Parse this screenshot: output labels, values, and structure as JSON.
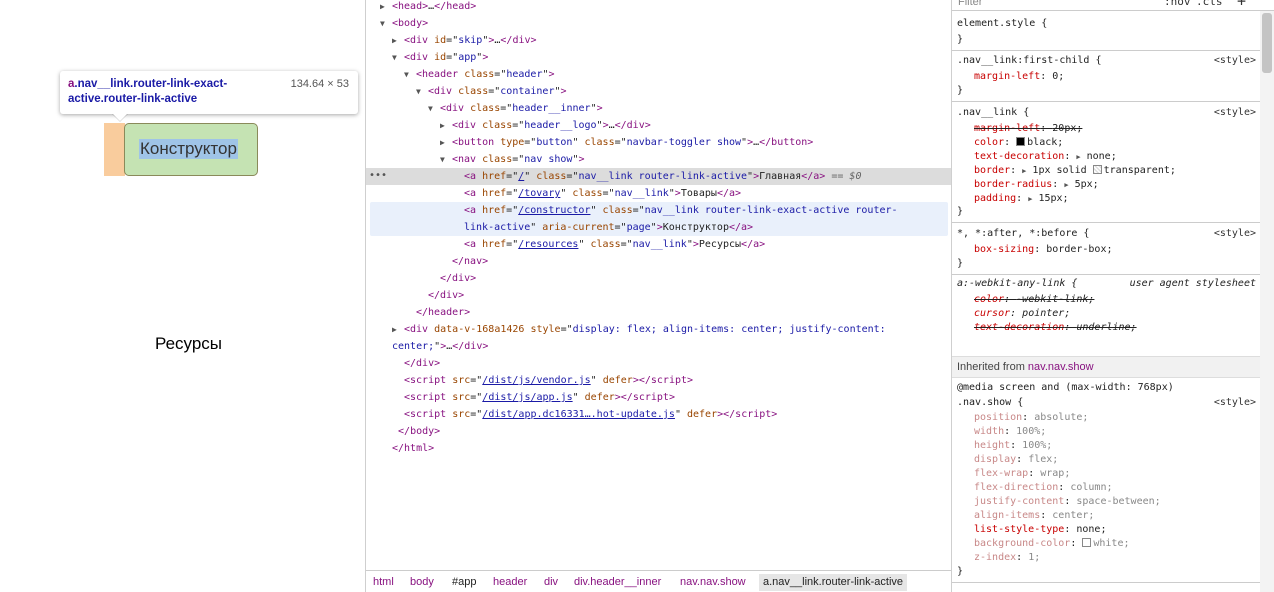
{
  "preview": {
    "tooltip_selector_tag": "a",
    "tooltip_selector_classes": ".nav__link.router-link-exact-active.router-link-active",
    "tooltip_dimensions": "134.64 × 53",
    "highlighted_link_text": "Конструктор",
    "resources_link_text": "Ресурсы"
  },
  "elements": {
    "lines": [
      {
        "indent": 0,
        "tri": "▶",
        "html": "<span class='tg'>&lt;head&gt;</span>…<span class='tg'>&lt;/head&gt;</span>"
      },
      {
        "indent": 0,
        "tri": "▼",
        "html": "<span class='tg'>&lt;body&gt;</span>"
      },
      {
        "indent": 1,
        "tri": "▶",
        "html": "<span class='tg'>&lt;div</span> <span class='an'>id</span>=\"<span class='av'>skip</span>\"<span class='tg'>&gt;</span>…<span class='tg'>&lt;/div&gt;</span>"
      },
      {
        "indent": 1,
        "tri": "▼",
        "html": "<span class='tg'>&lt;div</span> <span class='an'>id</span>=\"<span class='av'>app</span>\"<span class='tg'>&gt;</span>"
      },
      {
        "indent": 2,
        "tri": "▼",
        "html": "<span class='tg'>&lt;header</span> <span class='an'>class</span>=\"<span class='av'>header</span>\"<span class='tg'>&gt;</span>"
      },
      {
        "indent": 3,
        "tri": "▼",
        "html": "<span class='tg'>&lt;div</span> <span class='an'>class</span>=\"<span class='av'>container</span>\"<span class='tg'>&gt;</span>"
      },
      {
        "indent": 4,
        "tri": "▼",
        "html": "<span class='tg'>&lt;div</span> <span class='an'>class</span>=\"<span class='av'>header__inner</span>\"<span class='tg'>&gt;</span>"
      },
      {
        "indent": 5,
        "tri": "▶",
        "html": "<span class='tg'>&lt;div</span> <span class='an'>class</span>=\"<span class='av'>header__logo</span>\"<span class='tg'>&gt;</span>…<span class='tg'>&lt;/div&gt;</span>"
      },
      {
        "indent": 5,
        "tri": "▶",
        "html": "<span class='tg'>&lt;button</span> <span class='an'>type</span>=\"<span class='av'>button</span>\" <span class='an'>class</span>=\"<span class='av'>navbar-toggler show</span>\"<span class='tg'>&gt;</span>…<span class='tg'>&lt;/button&gt;</span>"
      },
      {
        "indent": 5,
        "tri": "▼",
        "html": "<span class='tg'>&lt;nav</span> <span class='an'>class</span>=\"<span class='av'>nav show</span>\"<span class='tg'>&gt;</span>"
      },
      {
        "indent": 6,
        "tri": "",
        "hl": "gray",
        "html": "<span class='tg'>&lt;a</span> <span class='an'>href</span>=\"<span class='lk'>/</span>\" <span class='an'>class</span>=\"<span class='av'>nav__link router-link-active</span>\"<span class='tg'>&gt;</span><span class='tx'>Главная</span><span class='tg'>&lt;/a&gt;</span> <span class='cm'>== $0</span>"
      },
      {
        "indent": 6,
        "tri": "",
        "html": "<span class='tg'>&lt;a</span> <span class='an'>href</span>=\"<span class='lk'>/tovary</span>\" <span class='an'>class</span>=\"<span class='av'>nav__link</span>\"<span class='tg'>&gt;</span><span class='tx'>Товары</span><span class='tg'>&lt;/a&gt;</span>"
      },
      {
        "indent": 6,
        "tri": "",
        "hl": "blue",
        "html": "<span class='tg'>&lt;a</span> <span class='an'>href</span>=\"<span class='lk'>/constructor</span>\" <span class='an'>class</span>=\"<span class='av'>nav__link router-link-exact-active router-</span>"
      },
      {
        "indent": 6,
        "tri": "",
        "html": "<span class='av'>link-active</span>\" <span class='an'>aria-current</span>=\"<span class='av'>page</span>\"<span class='tg'>&gt;</span><span class='tx'>Конструктор</span><span class='tg'>&lt;/a&gt;</span>"
      },
      {
        "indent": 6,
        "tri": "",
        "html": "<span class='tg'>&lt;a</span> <span class='an'>href</span>=\"<span class='lk'>/resources</span>\" <span class='an'>class</span>=\"<span class='av'>nav__link</span>\"<span class='tg'>&gt;</span><span class='tx'>Ресурсы</span><span class='tg'>&lt;/a&gt;</span>"
      },
      {
        "indent": 5,
        "tri": "",
        "html": "<span class='tg'>&lt;/nav&gt;</span>"
      },
      {
        "indent": 4,
        "tri": "",
        "html": "<span class='tg'>&lt;/div&gt;</span>"
      },
      {
        "indent": 3,
        "tri": "",
        "html": "<span class='tg'>&lt;/div&gt;</span>"
      },
      {
        "indent": 2,
        "tri": "",
        "html": "<span class='tg'>&lt;/header&gt;</span>"
      },
      {
        "indent": 1,
        "tri": "▶",
        "html": "<span class='tg'>&lt;div</span> <span class='an'>data-v-168a1426</span> <span class='an'>style</span>=\"<span class='av'>display: flex; align-items: center; justify-content:</span>"
      },
      {
        "indent": 0,
        "tri": "",
        "html": "<span class='av'>center;</span>\"<span class='tg'>&gt;</span>…<span class='tg'>&lt;/div&gt;</span>"
      },
      {
        "indent": 1,
        "tri": "",
        "html": "<span class='tg'>&lt;/div&gt;</span>"
      },
      {
        "indent": 1,
        "tri": "",
        "html": "<span class='tg'>&lt;script</span> <span class='an'>src</span>=\"<span class='lk'>/dist/js/vendor.js</span>\" <span class='an'>defer</span><span class='tg'>&gt;&lt;/script&gt;</span>"
      },
      {
        "indent": 1,
        "tri": "",
        "html": "<span class='tg'>&lt;script</span> <span class='an'>src</span>=\"<span class='lk'>/dist/js/app.js</span>\" <span class='an'>defer</span><span class='tg'>&gt;&lt;/script&gt;</span>"
      },
      {
        "indent": 1,
        "tri": "",
        "html": "<span class='tg'>&lt;script</span> <span class='an'>src</span>=\"<span class='lk'>/dist/app.dc16331….hot-update.js</span>\" <span class='an'>defer</span><span class='tg'>&gt;&lt;/script&gt;</span>"
      },
      {
        "indent": 0,
        "tri": "",
        "html": "&nbsp;<span class='tg'>&lt;/body&gt;</span>"
      },
      {
        "indent": 0,
        "tri": "",
        "html": "<span class='tg'>&lt;/html&gt;</span>"
      }
    ],
    "dots": "•••",
    "breadcrumb": [
      "html",
      "body",
      "#app",
      "header",
      "div",
      "div.header__inner",
      "nav.nav.show",
      "a.nav__link.router-link-active"
    ]
  },
  "styles": {
    "filter_placeholder": "Filter",
    "hov_label": ":hov",
    "cls_label": ".cls",
    "add_label": "+",
    "element_style_selector": "element.style {",
    "close_brace": "}",
    "rule1_selector": ".nav__link:first-child {",
    "rule1_source": "<style>",
    "rule1_prop": "margin-left",
    "rule1_val": "0;",
    "rule2_selector": ".nav__link {",
    "rule2_source": "<style>",
    "rule2_props": [
      {
        "p": "margin-left",
        "v": "20px;",
        "struck": true
      },
      {
        "p": "color",
        "v": "black;",
        "swatch": "black"
      },
      {
        "p": "text-decoration",
        "v": "none;",
        "arrow": true
      },
      {
        "p": "border",
        "v": "1px solid ",
        "arrow": true,
        "swatch_after": "transparent",
        "v2": "transparent;"
      },
      {
        "p": "border-radius",
        "v": "5px;",
        "arrow": true
      },
      {
        "p": "padding",
        "v": "15px;",
        "arrow": true
      }
    ],
    "rule3_selector": "*, *:after, *:before {",
    "rule3_source": "<style>",
    "rule3_prop": "box-sizing",
    "rule3_val": "border-box;",
    "rule4_selector": "a:-webkit-any-link {",
    "rule4_source": "user agent stylesheet",
    "rule4_props": [
      {
        "p": "color",
        "v": "-webkit-link;",
        "struck": true
      },
      {
        "p": "cursor",
        "v": "pointer;",
        "struck": false
      },
      {
        "p": "text-decoration",
        "v": "underline;",
        "struck": true
      }
    ],
    "inherited_label": "Inherited from ",
    "inherited_from": "nav.nav.show",
    "media_query": "@media screen and (max-width: 768px)",
    "rule5_selector": ".nav.show {",
    "rule5_source": "<style>",
    "rule5_props": [
      {
        "p": "position",
        "v": "absolute;",
        "dim": true
      },
      {
        "p": "width",
        "v": "100%;",
        "dim": true
      },
      {
        "p": "height",
        "v": "100%;",
        "dim": true
      },
      {
        "p": "display",
        "v": "flex;",
        "dim": true
      },
      {
        "p": "flex-wrap",
        "v": "wrap;",
        "dim": true
      },
      {
        "p": "flex-direction",
        "v": "column;",
        "dim": true
      },
      {
        "p": "justify-content",
        "v": "space-between;",
        "dim": true
      },
      {
        "p": "align-items",
        "v": "center;",
        "dim": true
      },
      {
        "p": "list-style-type",
        "v": "none;",
        "dim": false
      },
      {
        "p": "background-color",
        "v": "white;",
        "dim": true,
        "swatch": "white"
      },
      {
        "p": "z-index",
        "v": "1;",
        "dim": true
      }
    ]
  }
}
